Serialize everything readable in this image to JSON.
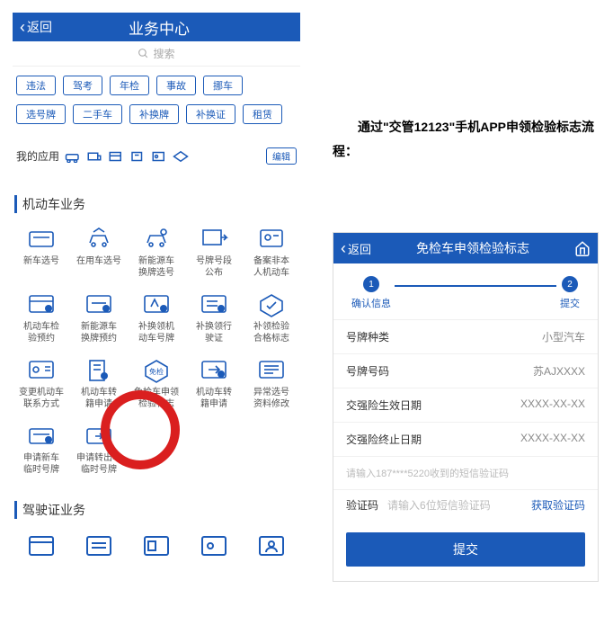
{
  "left": {
    "back": "返回",
    "title": "业务中心",
    "search_placeholder": "搜索",
    "tags_row1": [
      "违法",
      "驾考",
      "年检",
      "事故",
      "挪车"
    ],
    "tags_row2": [
      "选号牌",
      "二手车",
      "补换牌",
      "补换证",
      "租赁"
    ],
    "my_apps_label": "我的应用",
    "edit_label": "编辑",
    "section_vehicle": "机动车业务",
    "vehicle_items": [
      "新车选号",
      "在用车选号",
      "新能源车\n换牌选号",
      "号牌号段\n公布",
      "备案非本\n人机动车",
      "机动车检\n验预约",
      "新能源车\n换牌预约",
      "补换领机\n动车号牌",
      "补换领行\n驶证",
      "补领检验\n合格标志",
      "变更机动车\n联系方式",
      "机动车转\n籍申请",
      "免检车申领\n检验标志",
      "机动车转\n籍申请",
      "异常选号\n资料修改",
      "申请新车\n临时号牌",
      "申请转出车\n临时号牌"
    ],
    "section_license": "驾驶证业务"
  },
  "instruction": "　　通过\"交管12123\"手机APP申领检验标志流程：",
  "right": {
    "back": "返回",
    "title": "免检车申领检验标志",
    "step1": "确认信息",
    "step2": "提交",
    "rows": [
      {
        "label": "号牌种类",
        "value": "小型汽车"
      },
      {
        "label": "号牌号码",
        "value": "苏AJXXXX"
      },
      {
        "label": "交强险生效日期",
        "value": "XXXX-XX-XX"
      },
      {
        "label": "交强险终止日期",
        "value": "XXXX-XX-XX"
      }
    ],
    "hint": "请输入187****5220收到的短信验证码",
    "verify_label": "验证码",
    "verify_placeholder": "请输入6位短信验证码",
    "get_code": "获取验证码",
    "submit": "提交"
  }
}
